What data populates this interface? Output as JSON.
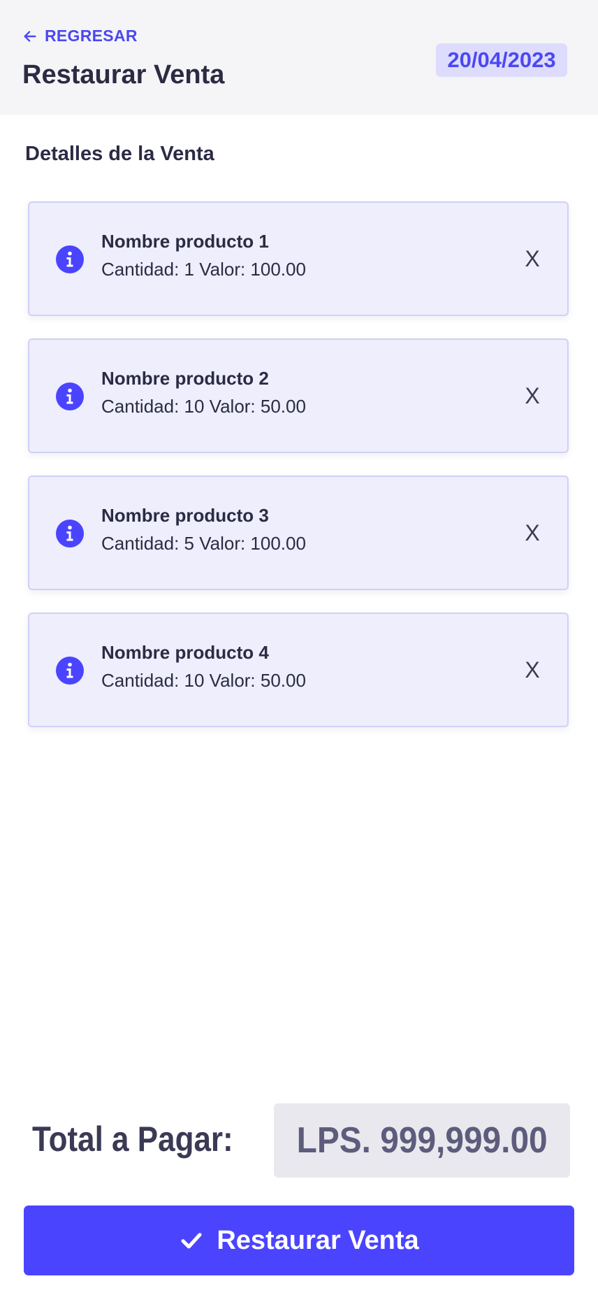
{
  "header": {
    "back_label": "REGRESAR",
    "title": "Restaurar Venta",
    "date": "20/04/2023"
  },
  "section": {
    "title": "Detalles de la Venta"
  },
  "items": [
    {
      "name": "Nombre producto 1",
      "detail": "Cantidad: 1 Valor: 100.00",
      "remove": "X"
    },
    {
      "name": "Nombre producto 2",
      "detail": "Cantidad: 10 Valor: 50.00",
      "remove": "X"
    },
    {
      "name": "Nombre producto 3",
      "detail": "Cantidad: 5 Valor: 100.00",
      "remove": "X"
    },
    {
      "name": "Nombre producto 4",
      "detail": "Cantidad: 10 Valor: 50.00",
      "remove": "X"
    }
  ],
  "total": {
    "label": "Total a Pagar:",
    "value": "LPS. 999,999.00"
  },
  "action": {
    "label": "Restaurar Venta"
  },
  "icons": {
    "back": "arrow-left-icon",
    "info": "info-icon",
    "check": "check-icon"
  },
  "colors": {
    "accent": "#4b44ff",
    "card_background": "#eeeefc",
    "date_badge_background": "#dedcfc"
  }
}
